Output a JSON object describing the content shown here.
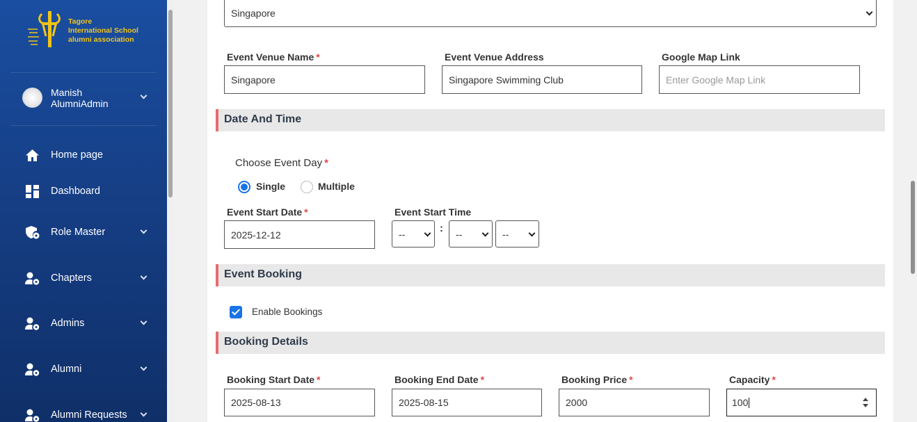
{
  "brand": {
    "logo_lines": [
      "Tagore",
      "International School",
      "alumni association"
    ]
  },
  "user": {
    "first_line": "Manish",
    "second_line": "AlumniAdmin"
  },
  "sidebar": {
    "items": [
      {
        "label": "Home page",
        "icon": "home-icon"
      },
      {
        "label": "Dashboard",
        "icon": "dashboard-icon"
      },
      {
        "label": "Role Master",
        "icon": "shield-gear-icon"
      },
      {
        "label": "Chapters",
        "icon": "user-gear-icon"
      },
      {
        "label": "Admins",
        "icon": "user-gear-icon"
      },
      {
        "label": "Alumni",
        "icon": "user-gear-icon"
      },
      {
        "label": "Alumni Requests",
        "icon": "user-gear-icon"
      }
    ]
  },
  "form": {
    "country_select": "Singapore",
    "venue": {
      "name_label": "Event Venue Name",
      "name_value": "Singapore",
      "address_label": "Event Venue Address",
      "address_value": "Singapore Swimming Club",
      "map_label": "Google Map Link",
      "map_placeholder": "Enter Google Map Link"
    },
    "date_time": {
      "section_title": "Date And Time",
      "choose_day_label": "Choose Event Day",
      "option_single": "Single",
      "option_multiple": "Multiple",
      "selected_option": "Single",
      "start_date_label": "Event Start Date",
      "start_date_value": "2025-12-12",
      "start_time_label": "Event Start Time",
      "hour_value": "--",
      "time_separator": ":",
      "minute_value": "--",
      "ampm_value": "--"
    },
    "booking": {
      "section_title": "Event Booking",
      "enable_label": "Enable Bookings",
      "enabled": true
    },
    "booking_details": {
      "section_title": "Booking Details",
      "start_label": "Booking Start Date",
      "start_value": "2025-08-13",
      "end_label": "Booking End Date",
      "end_value": "2025-08-15",
      "price_label": "Booking Price",
      "price_value": "2000",
      "capacity_label": "Capacity",
      "capacity_value": "100"
    },
    "required_mark": "*"
  },
  "colors": {
    "sidebar_top": "#1a4ea1",
    "sidebar_bottom": "#0f2f68",
    "logo_gold": "#f2c418",
    "section_accent": "#e36d6d",
    "control_blue": "#1a73e8"
  }
}
